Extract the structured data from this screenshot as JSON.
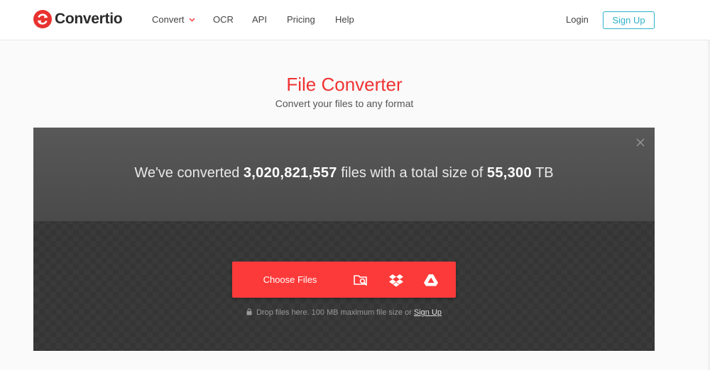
{
  "brand": {
    "name": "Convertio",
    "color": "#f03232"
  },
  "nav": {
    "items": [
      {
        "label": "Convert",
        "has_dropdown": true
      },
      {
        "label": "OCR"
      },
      {
        "label": "API"
      },
      {
        "label": "Pricing"
      },
      {
        "label": "Help"
      }
    ],
    "login_label": "Login",
    "signup_label": "Sign Up",
    "signup_color": "#2eb1c9"
  },
  "hero": {
    "title": "File Converter",
    "subtitle": "Convert your files to any format"
  },
  "stats": {
    "prefix": "We've converted",
    "files_count": "3,020,821,557",
    "middle": "files with a total size of",
    "total_size": "55,300",
    "unit": "TB"
  },
  "upload": {
    "choose_label": "Choose Files",
    "button_color": "#fd3a3a",
    "sources": [
      "folder-search-icon",
      "dropbox-icon",
      "google-drive-icon"
    ],
    "drop_note": "Drop files here. 100 MB maximum file size or",
    "signup_link": "Sign Up"
  }
}
